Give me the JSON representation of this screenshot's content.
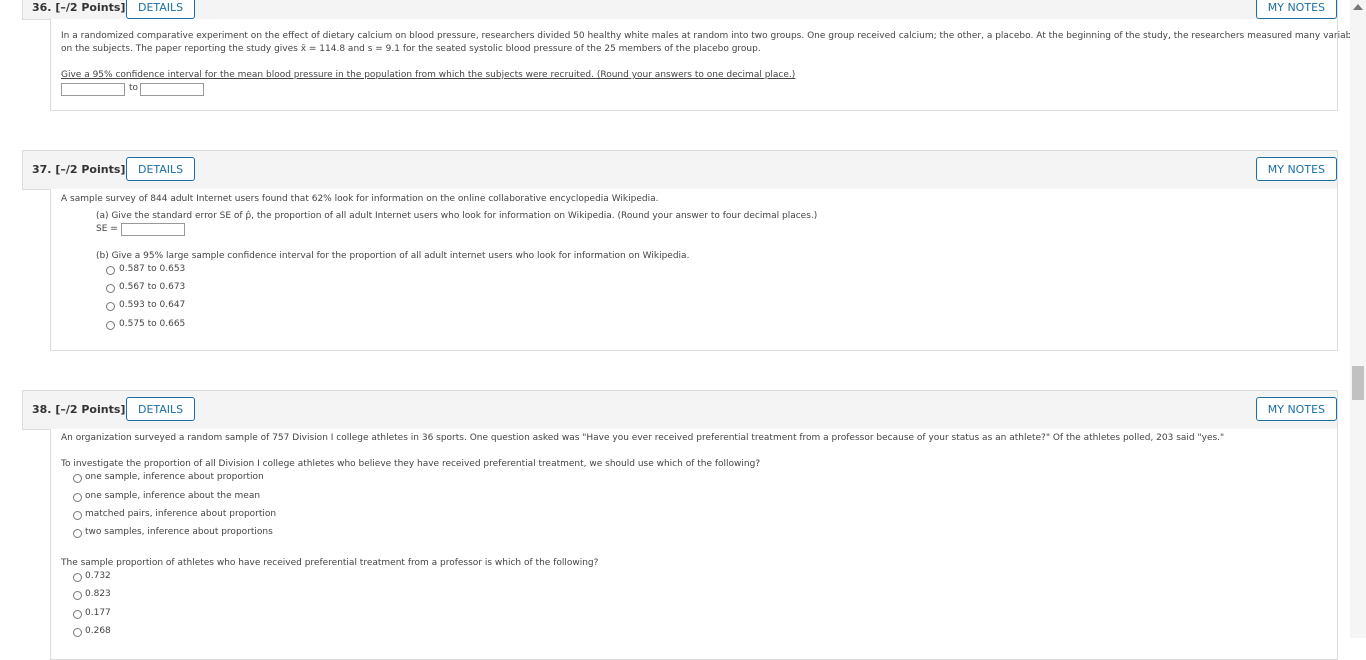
{
  "q36": {
    "number": "36.",
    "points": "[–/2 Points]",
    "details": "DETAILS",
    "notes": "MY NOTES",
    "text_line1": "In a randomized comparative experiment on the effect of dietary calcium on blood pressure, researchers divided 50 healthy white males at random into two groups. One group received calcium; the other, a placebo. At the beginning of the study, the researchers measured many variables",
    "text_line2": "on the subjects. The paper reporting the study gives x̄ = 114.8 and s = 9.1 for the seated systolic blood pressure of the 25 members of the placebo group.",
    "prompt": "Give a 95% confidence interval for the mean blood pressure in the population from which the subjects were recruited. (Round your answers to one decimal place.)",
    "to": "to",
    "low_value": "",
    "high_value": ""
  },
  "q37": {
    "number": "37.",
    "points": "[–/2 Points]",
    "details": "DETAILS",
    "notes": "MY NOTES",
    "intro": "A sample survey of 844 adult Internet users found that 62% look for information on the online collaborative encyclopedia Wikipedia.",
    "part_a": "(a) Give the standard error SE of p̂, the proportion of all adult Internet users who look for information on Wikipedia. (Round your answer to four decimal places.)",
    "se_label": "SE =",
    "se_value": "",
    "part_b": "(b) Give a 95% large sample confidence interval for the proportion of all adult internet users who look for information on Wikipedia.",
    "options": [
      "0.587 to 0.653",
      "0.567 to 0.673",
      "0.593 to 0.647",
      "0.575 to 0.665"
    ]
  },
  "q38": {
    "number": "38.",
    "points": "[–/2 Points]",
    "details": "DETAILS",
    "notes": "MY NOTES",
    "intro": "An organization surveyed a random sample of 757 Division I college athletes in 36 sports. One question asked was \"Have you ever received preferential treatment from a professor because of your status as an athlete?\" Of the athletes polled, 203 said \"yes.\"",
    "q1": "To investigate the proportion of all Division I college athletes who believe they have received preferential treatment, we should use which of the following?",
    "q1_options": [
      "one sample, inference about proportion",
      "one sample, inference about the mean",
      "matched pairs, inference about proportion",
      "two samples, inference about proportions"
    ],
    "q2": "The sample proportion of athletes who have received preferential treatment from a professor is which of the following?",
    "q2_options": [
      "0.732",
      "0.823",
      "0.177",
      "0.268"
    ]
  }
}
